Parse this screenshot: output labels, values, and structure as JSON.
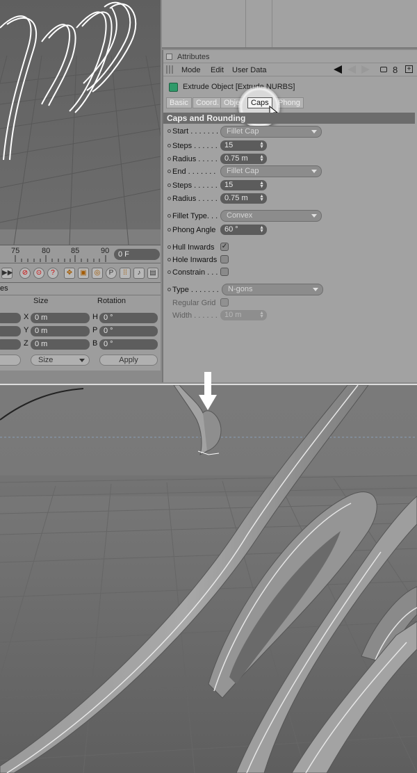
{
  "timeline": {
    "ticks": [
      "75",
      "80",
      "85",
      "90"
    ],
    "frame": "0 F"
  },
  "coords": {
    "partial_label": "es",
    "headers": {
      "size": "Size",
      "rotation": "Rotation"
    },
    "axes_pos": [
      "X",
      "Y",
      "Z"
    ],
    "axes_rot": [
      "H",
      "P",
      "B"
    ],
    "pos_values": [
      "0 m",
      "0 m",
      "0 m"
    ],
    "rot_values": [
      "0 °",
      "0 °",
      "0 °"
    ],
    "size_dropdown": "Size",
    "apply_button": "Apply"
  },
  "attributes": {
    "panel_title": "Attributes",
    "menu": [
      "Mode",
      "Edit",
      "User Data"
    ],
    "object_title": "Extrude Object [Extrude NURBS]",
    "tabs": [
      "Basic",
      "Coord.",
      "Object",
      "Caps",
      "Phong"
    ],
    "active_tab": "Caps",
    "section_title": "Caps and Rounding",
    "rows": {
      "start_label": "Start . . . . . . .",
      "start_value": "Fillet Cap",
      "steps1_label": "Steps . . . . . .",
      "steps1_value": "15",
      "radius1_label": "Radius . . . . .",
      "radius1_value": "0.75 m",
      "end_label": "End  . . . . . . .",
      "end_value": "Fillet Cap",
      "steps2_label": "Steps . . . . . .",
      "steps2_value": "15",
      "radius2_label": "Radius . . . . .",
      "radius2_value": "0.75 m",
      "fillet_type_label": "Fillet Type. . .",
      "fillet_type_value": "Convex",
      "phong_angle_label": "Phong Angle",
      "phong_angle_value": "60 °",
      "hull_inwards_label": "Hull Inwards",
      "hull_inwards_checked": "✓",
      "hole_inwards_label": "Hole Inwards",
      "constrain_label": "Constrain . . .",
      "type_label": "Type . . . . . . .",
      "type_value": "N-gons",
      "regular_grid_label": "Regular Grid",
      "width_label": "Width . . . . . .",
      "width_value": "10 m"
    }
  },
  "colors": {
    "panel_bg": "#a2a2a2",
    "section_bar": "#6c6c6c",
    "field_bg": "#5c5c5c",
    "viewport_bg": "#6c6c6c",
    "highlight_ring": "#ffffff"
  }
}
